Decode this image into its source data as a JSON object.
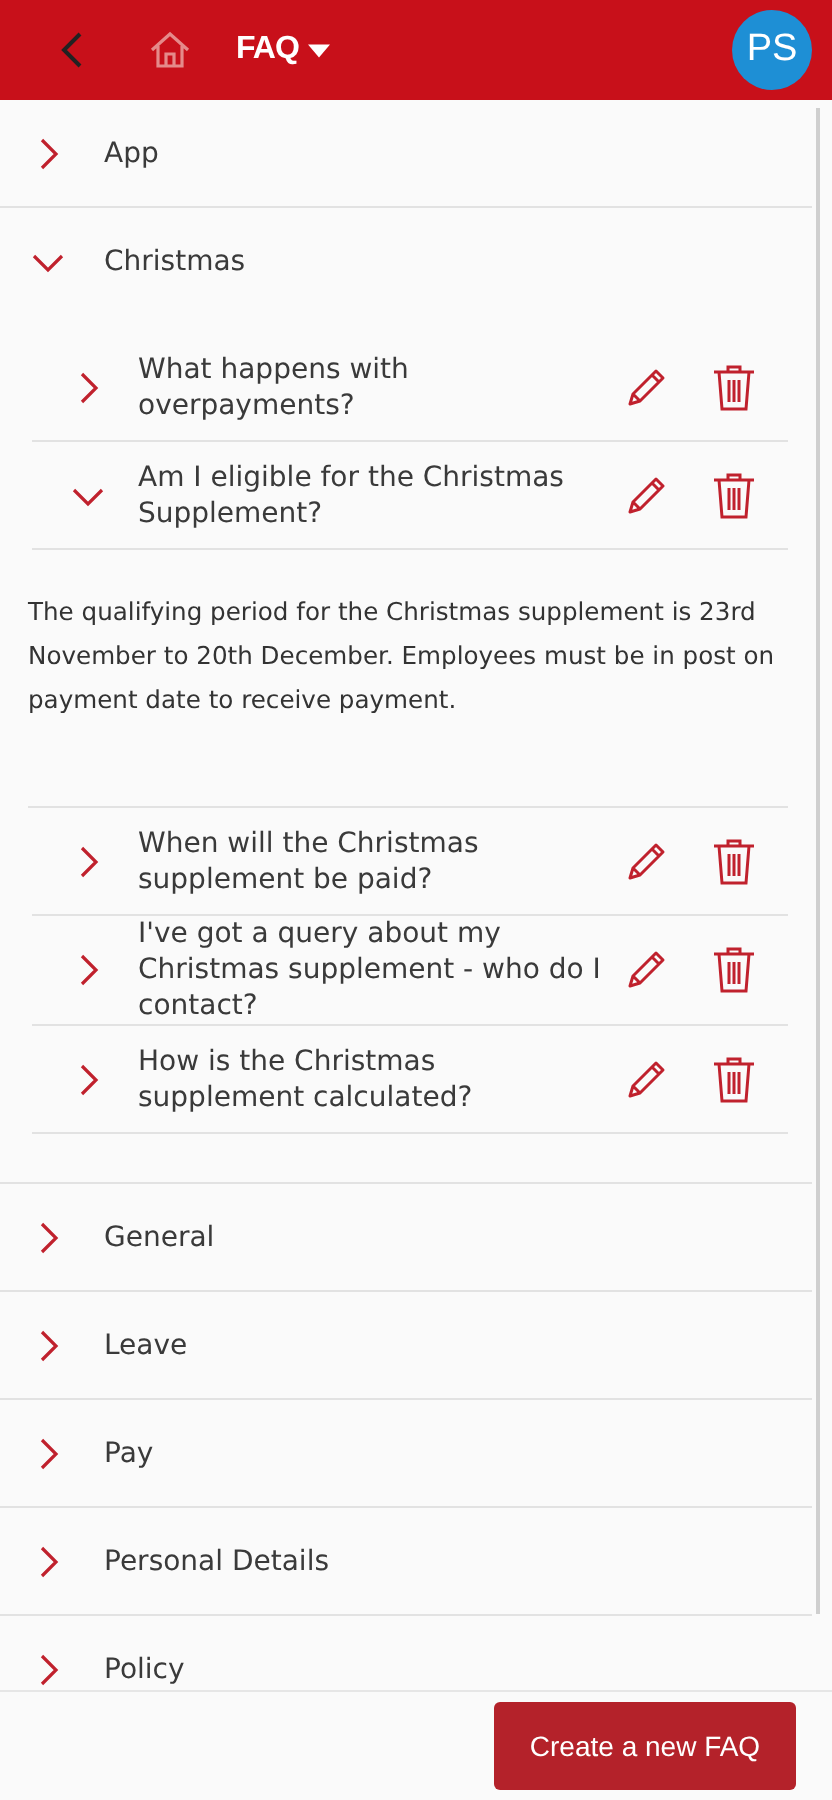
{
  "header": {
    "title": "FAQ",
    "avatar": "PS"
  },
  "categories": [
    {
      "label": "App",
      "expanded": false
    },
    {
      "label": "Christmas",
      "expanded": true,
      "questions": [
        {
          "question": "What happens with overpayments?",
          "expanded": false
        },
        {
          "question": "Am I eligible for the Christmas Supplement?",
          "expanded": true,
          "answer": "The qualifying period for the Christmas supplement is 23rd November to 20th December. Employees must be in post on payment date to receive payment."
        },
        {
          "question": "When will the Christmas supplement be paid?",
          "expanded": false
        },
        {
          "question": "I've got a query about my Christmas supplement - who do I contact?",
          "expanded": false
        },
        {
          "question": "How is the Christmas supplement calculated?",
          "expanded": false
        }
      ]
    },
    {
      "label": "General",
      "expanded": false
    },
    {
      "label": "Leave",
      "expanded": false
    },
    {
      "label": "Pay",
      "expanded": false
    },
    {
      "label": "Personal Details",
      "expanded": false
    },
    {
      "label": "Policy",
      "expanded": false
    }
  ],
  "footer": {
    "button": "Create a new FAQ"
  }
}
